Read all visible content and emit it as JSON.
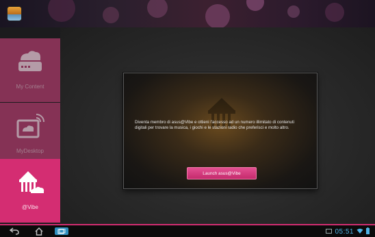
{
  "sidebar": {
    "items": [
      {
        "label": "My Content",
        "icon": "cloud-drive-icon",
        "state": "inactive"
      },
      {
        "label": "MyDesktop",
        "icon": "remote-desktop-cloud-icon",
        "state": "inactive"
      },
      {
        "label": "@Vibe",
        "icon": "vibe-tent-cloud-icon",
        "state": "active"
      }
    ]
  },
  "dialog": {
    "message": "Diventa membro di asus@Vibe e ottieni l'accesso ad un numero illimitato di contenuti digitali per trovare la musica, i giochi e le stazioni radio che preferisci e molto altro.",
    "button_label": "Launch asus@Vibe",
    "emblem": "vibe-emblem-icon"
  },
  "statusbar": {
    "time": "05:51",
    "icons": [
      "screenshot-icon",
      "wifi-icon",
      "battery-icon"
    ]
  },
  "navbar": {
    "buttons": [
      "back-icon",
      "home-icon",
      "recent-apps-icon"
    ]
  },
  "colors": {
    "accent": "#d42d72",
    "accent_muted": "#b23c6d",
    "clock": "#4fb3e6",
    "background": "#2a2a2a"
  }
}
